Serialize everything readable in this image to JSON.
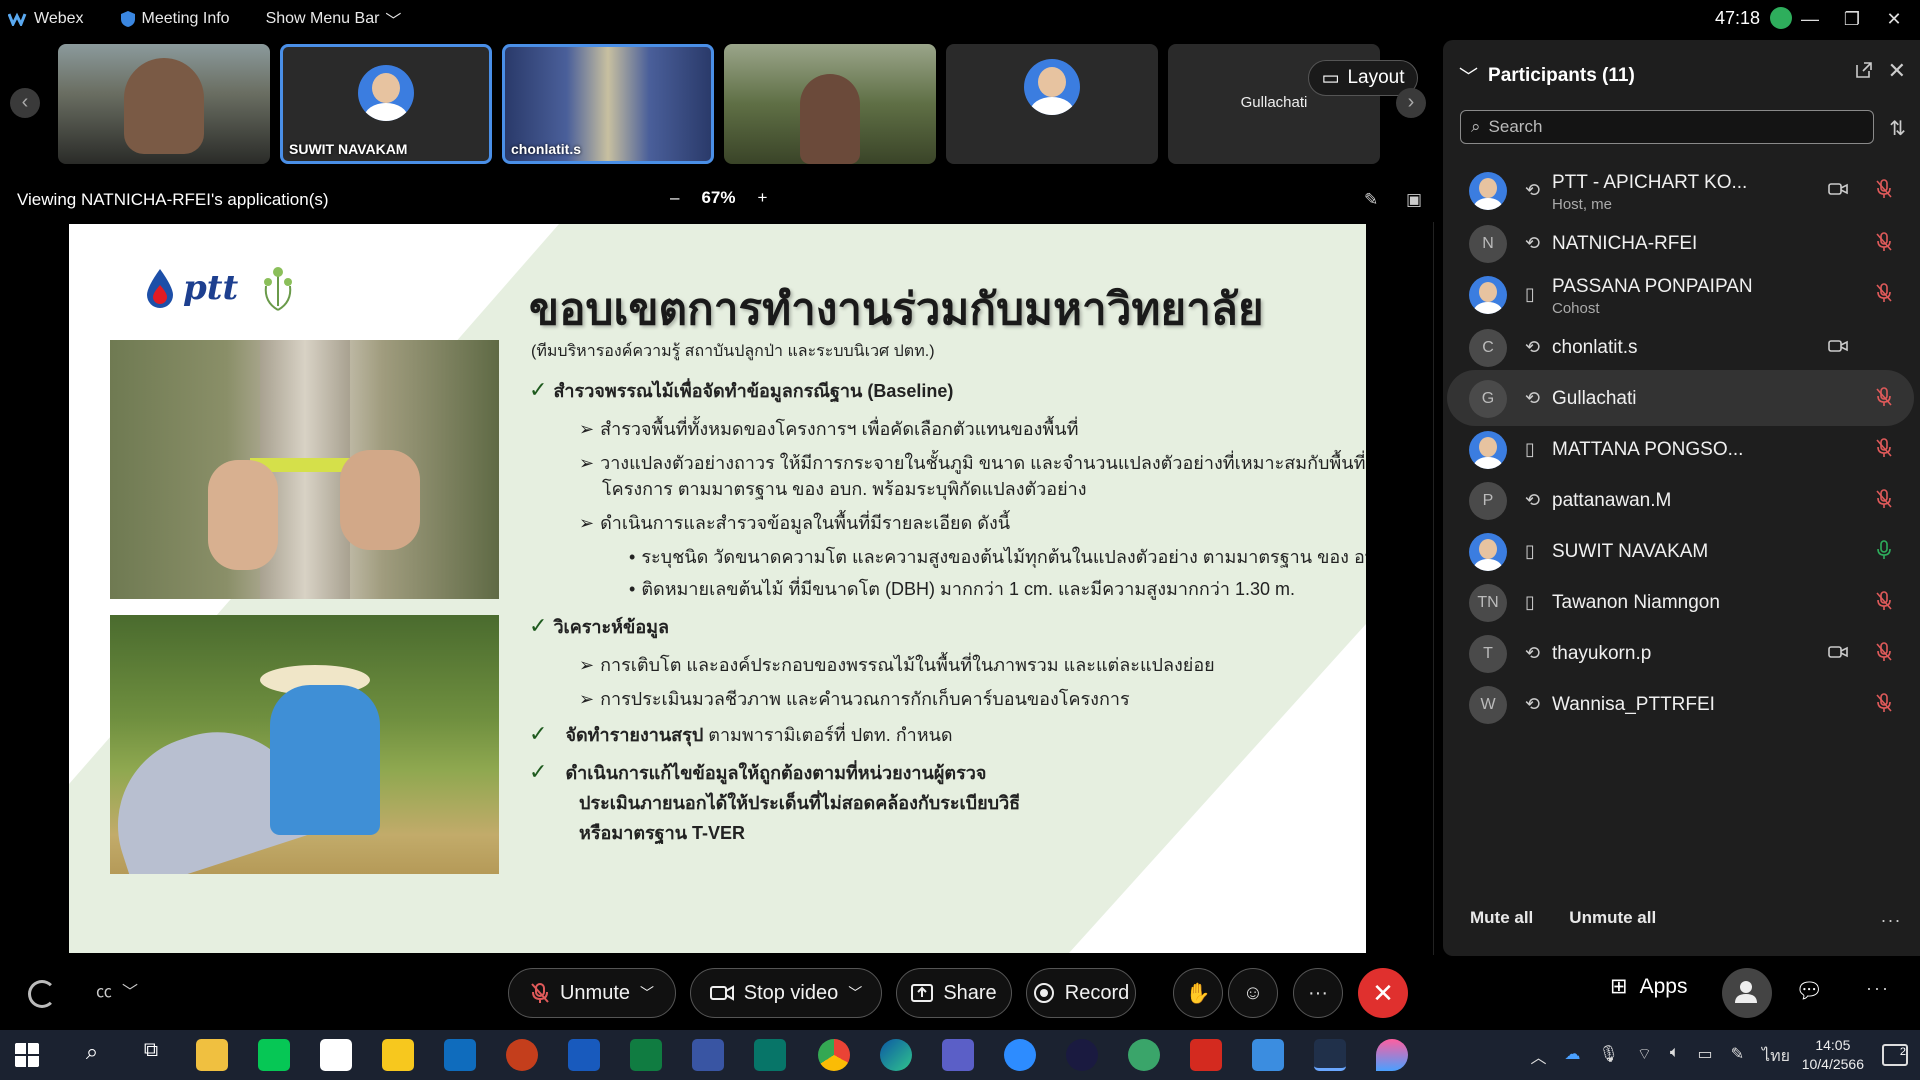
{
  "topbar": {
    "app_name": "Webex",
    "meeting_info": "Meeting Info",
    "show_menu_bar": "Show Menu Bar",
    "timer": "47:18"
  },
  "filmstrip": {
    "tiles": [
      {
        "name": ""
      },
      {
        "name": "SUWIT NAVAKAM"
      },
      {
        "name": "chonlatit.s"
      },
      {
        "name": ""
      },
      {
        "name": ""
      },
      {
        "name": "Gullachati"
      }
    ],
    "layout_label": "Layout"
  },
  "viewbar": {
    "viewing": "Viewing NATNICHA-RFEI's application(s)",
    "zoom_minus": "–",
    "zoom_level": "67%",
    "zoom_plus": "+"
  },
  "slide": {
    "ptt_text": "ptt",
    "title": "ขอบเขตการทำงานร่วมกับมหาวิทยาลัย",
    "subtitle": "(ทีมบริหารองค์ความรู้ สถาบันปลูกป่า และระบบนิเวศ ปตท.)",
    "check1": "สำรวจพรรณไม้เพื่อจัดทำข้อมูลกรณีฐาน (Baseline)",
    "c1_a": "สำรวจพื้นที่ทั้งหมดของโครงการฯ เพื่อคัดเลือกตัวแทนของพื้นที่",
    "c1_b1": "วางแปลงตัวอย่างถาวร ให้มีการกระจายในชั้นภูมิ ขนาด และจำนวนแปลงตัวอย่างที่เหมาะสมกับพื้นที่ของ",
    "c1_b2": "โครงการ ตามมาตรฐาน ของ อบก. พร้อมระบุพิกัดแปลงตัวอย่าง",
    "c1_c": "ดำเนินการและสำรวจข้อมูลในพื้นที่มีรายละเอียด ดังนี้",
    "c1_c_i": "ระบุชนิด วัดขนาดความโต และความสูงของต้นไม้ทุกต้นในแปลงตัวอย่าง ตามมาตรฐาน ของ อบก.",
    "c1_c_ii": "ติดหมายเลขต้นไม้ ที่มีขนาดโต (DBH) มากกว่า 1 cm. และมีความสูงมากกว่า 1.30 m.",
    "check2": "วิเคราะห์ข้อมูล",
    "c2_a": "การเติบโต และองค์ประกอบของพรรณไม้ในพื้นที่ในภาพรวม และแต่ละแปลงย่อย",
    "c2_b": "การประเมินมวลชีวภาพ และคำนวณการกักเก็บคาร์บอนของโครงการ",
    "check3_bold": "จัดทำรายงานสรุป",
    "check3_rest": " ตามพารามิเตอร์ที่ ปตท. กำหนด",
    "check4_l1": "ดำเนินการแก้ไขข้อมูลให้ถูกต้องตามที่หน่วยงานผู้ตรวจ",
    "check4_l2": "ประเมินภายนอกได้ให้ประเด็นที่ไม่สอดคล้องกับระเบียบวิธี",
    "check4_l3": "หรือมาตรฐาน T-VER"
  },
  "panel": {
    "title": "Participants (11)",
    "search_placeholder": "Search",
    "participants": [
      {
        "initials": "",
        "name": "PTT - APICHART KO...",
        "role": "Host, me",
        "video": true,
        "muted": true
      },
      {
        "initials": "N",
        "name": "NATNICHA-RFEI",
        "role": "",
        "video": false,
        "muted": true
      },
      {
        "initials": "",
        "name": "PASSANA PONPAIPAN",
        "role": "Cohost",
        "video": false,
        "muted": true
      },
      {
        "initials": "C",
        "name": "chonlatit.s",
        "role": "",
        "video": true,
        "muted": false
      },
      {
        "initials": "G",
        "name": "Gullachati",
        "role": "",
        "video": false,
        "muted": true
      },
      {
        "initials": "",
        "name": "MATTANA PONGSO...",
        "role": "",
        "video": false,
        "muted": true
      },
      {
        "initials": "P",
        "name": "pattanawan.M",
        "role": "",
        "video": false,
        "muted": true
      },
      {
        "initials": "",
        "name": "SUWIT NAVAKAM",
        "role": "",
        "video": false,
        "muted": false
      },
      {
        "initials": "TN",
        "name": "Tawanon Niamngon",
        "role": "",
        "video": false,
        "muted": true
      },
      {
        "initials": "T",
        "name": "thayukorn.p",
        "role": "",
        "video": true,
        "muted": true
      },
      {
        "initials": "W",
        "name": "Wannisa_PTTRFEI",
        "role": "",
        "video": false,
        "muted": true
      }
    ],
    "mute_all": "Mute all",
    "unmute_all": "Unmute all",
    "more": "..."
  },
  "controls": {
    "unmute": "Unmute",
    "stop_video": "Stop video",
    "share": "Share",
    "record": "Record",
    "more": "···",
    "apps": "Apps",
    "more_right": "···"
  },
  "taskbar": {
    "lang": "ไทย",
    "time": "14:05",
    "date": "10/4/2566",
    "notifications": "2"
  },
  "colors": {
    "accent": "#4a8fe7",
    "end_call": "#e0302e",
    "slide_bg": "#e6efe0",
    "muted_icon": "#e05a5a",
    "unmuted_icon": "#2eae5c"
  }
}
